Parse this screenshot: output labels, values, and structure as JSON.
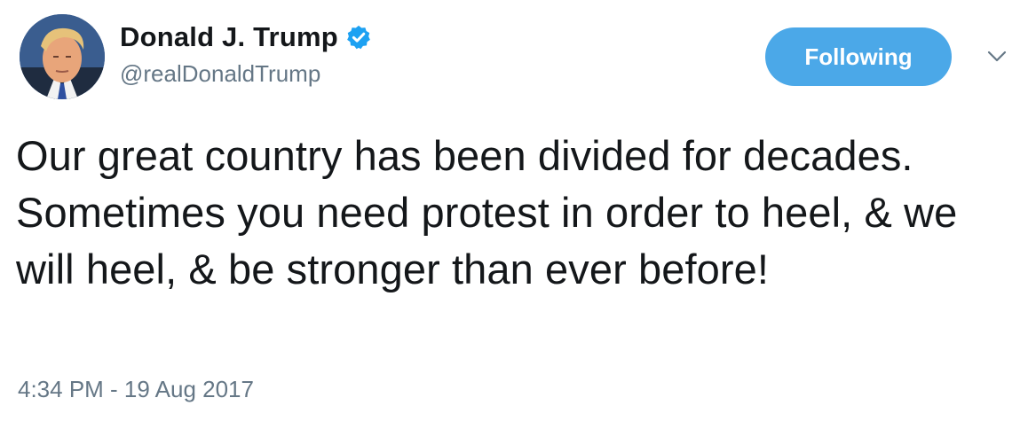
{
  "tweet": {
    "author": {
      "display_name": "Donald J. Trump",
      "handle": "@realDonaldTrump",
      "verified": true,
      "avatar_icon": "profile-photo"
    },
    "follow_button": {
      "label": "Following"
    },
    "menu_icon": "chevron-down-icon",
    "text": "Our great country has been divided for decades. Sometimes you need protest in order to heel, & we will heel, & be stronger than ever before!",
    "timestamp": "4:34 PM - 19 Aug 2017"
  },
  "colors": {
    "accent": "#4ba8e8",
    "verified_badge": "#1da1f2",
    "secondary_text": "#657786",
    "primary_text": "#14171a"
  }
}
